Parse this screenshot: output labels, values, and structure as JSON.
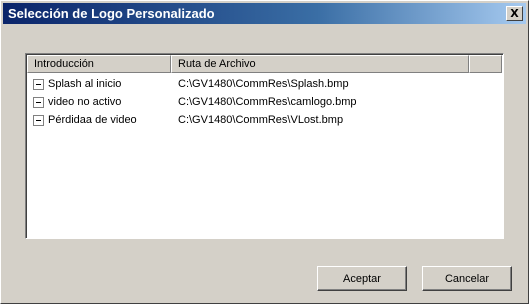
{
  "window": {
    "title": "Selección de Logo Personalizado",
    "close_label": "X"
  },
  "list": {
    "columns": [
      "Introducción",
      "Ruta de Archivo",
      ""
    ],
    "rows": [
      {
        "label": "Splash al inicio",
        "path": "C:\\GV1480\\CommRes\\Splash.bmp"
      },
      {
        "label": "video no activo",
        "path": "C:\\GV1480\\CommRes\\camlogo.bmp"
      },
      {
        "label": "Pérdidaa de video",
        "path": "C:\\GV1480\\CommRes\\VLost.bmp"
      }
    ]
  },
  "buttons": {
    "ok_label": "Aceptar",
    "cancel_label": "Cancelar"
  }
}
